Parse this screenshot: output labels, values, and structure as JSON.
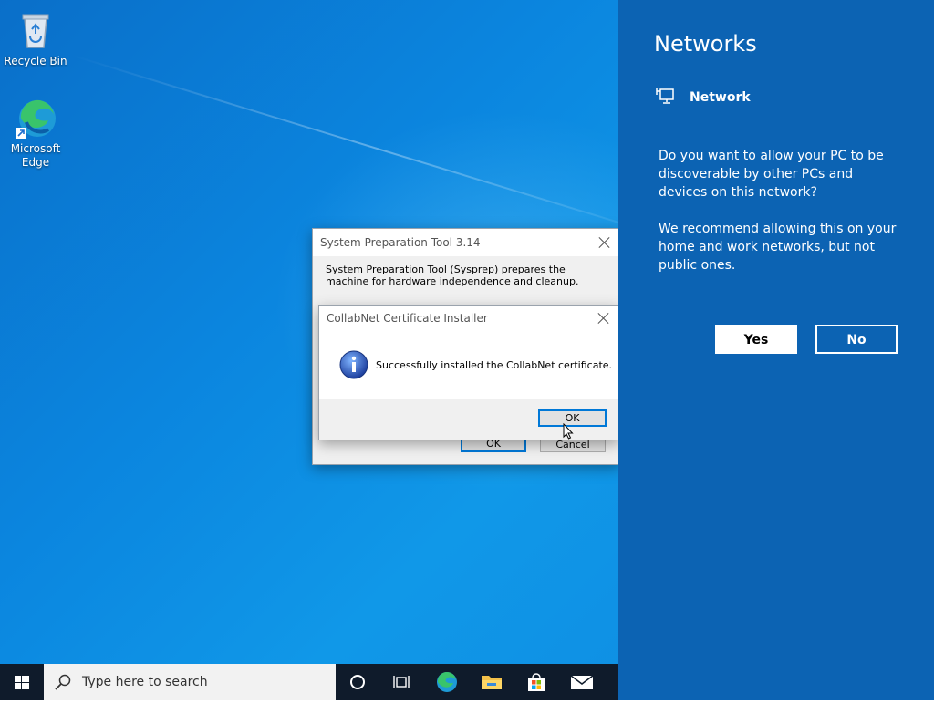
{
  "desktop": {
    "icons": [
      {
        "label": "Recycle Bin"
      },
      {
        "label": "Microsoft Edge"
      }
    ]
  },
  "sysprep": {
    "title": "System Preparation Tool 3.14",
    "description": "System Preparation Tool (Sysprep) prepares the machine for hardware independence and cleanup.",
    "ok_label": "OK",
    "cancel_label": "Cancel"
  },
  "collabnet": {
    "title": "CollabNet Certificate Installer",
    "message": "Successfully installed the CollabNet certificate.",
    "ok_label": "OK",
    "icon": "info-icon"
  },
  "networks": {
    "title": "Networks",
    "network_name": "Network",
    "question": "Do you want to allow your PC to be discoverable by other PCs and devices on this network?",
    "recommendation": "We recommend allowing this on your home and work networks, but not public ones.",
    "yes_label": "Yes",
    "no_label": "No"
  },
  "taskbar": {
    "search_placeholder": "Type here to search",
    "icons": [
      "windows-start-icon",
      "search-icon",
      "cortana-icon",
      "task-view-icon",
      "edge-icon",
      "file-explorer-icon",
      "store-icon",
      "mail-icon"
    ]
  },
  "colors": {
    "pane_bg": "#0c63b3",
    "taskbar_bg": "#0f1b2b",
    "accent": "#0078d7"
  }
}
